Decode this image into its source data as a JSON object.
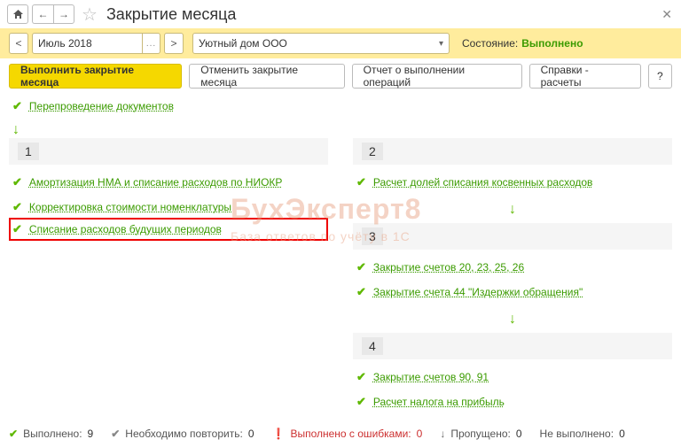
{
  "title": "Закрытие месяца",
  "period": "Июль 2018",
  "organization": "Уютный дом ООО",
  "state_label": "Состояние:",
  "state_value": "Выполнено",
  "buttons": {
    "execute": "Выполнить закрытие месяца",
    "cancel": "Отменить закрытие месяца",
    "report": "Отчет о выполнении операций",
    "refs": "Справки - расчеты",
    "help": "?"
  },
  "top_op": "Перепроведение документов",
  "col1": {
    "num": "1",
    "items": [
      "Амортизация НМА и списание расходов по НИОКР",
      "Корректировка стоимости номенклатуры",
      "Списание расходов будущих периодов"
    ]
  },
  "col2": {
    "s1": {
      "num": "2",
      "items": [
        "Расчет долей списания косвенных расходов"
      ]
    },
    "s2": {
      "num": "3",
      "items": [
        "Закрытие счетов 20, 23, 25, 26",
        "Закрытие счета 44 \"Издержки обращения\""
      ]
    },
    "s3": {
      "num": "4",
      "items": [
        "Закрытие счетов 90, 91",
        "Расчет налога на прибыль"
      ]
    }
  },
  "footer": {
    "done_label": "Выполнено:",
    "done_count": "9",
    "repeat_label": "Необходимо повторить:",
    "repeat_count": "0",
    "errors_label": "Выполнено с ошибками:",
    "errors_count": "0",
    "skipped_label": "Пропущено:",
    "skipped_count": "0",
    "not_done_label": "Не выполнено:",
    "not_done_count": "0"
  },
  "watermark": {
    "l1": "БухЭксперт8",
    "l2": "База ответов по учёту в 1С"
  }
}
